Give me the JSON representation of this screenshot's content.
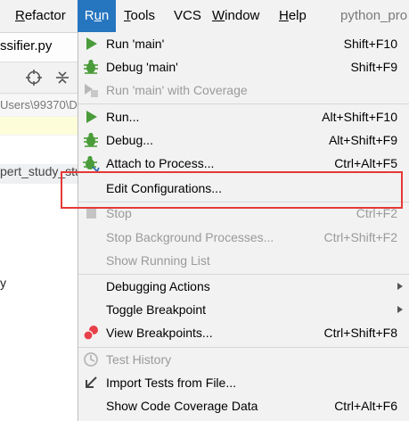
{
  "menubar": {
    "items": [
      {
        "label": "Refactor",
        "mnemonic": "R",
        "rest": "efactor"
      },
      {
        "label": "Run",
        "mnemonic": "u",
        "pre": "R",
        "rest": "n"
      },
      {
        "label": "Tools",
        "mnemonic": "T",
        "rest": "ools"
      },
      {
        "label": "VCS",
        "mnemonic": "",
        "rest": "VCS"
      },
      {
        "label": "Window",
        "mnemonic": "W",
        "rest": "indow"
      },
      {
        "label": "Help",
        "mnemonic": "H",
        "rest": "elp"
      }
    ],
    "project": "python_pro"
  },
  "editor": {
    "tab": "ssifier.py",
    "path": "Users\\99370\\D",
    "tree_item": "pert_study_stu",
    "tree_item2": "y"
  },
  "run_menu": {
    "items": [
      {
        "label": "Run 'main'",
        "shortcut": "Shift+F10"
      },
      {
        "label": "Debug 'main'",
        "shortcut": "Shift+F9"
      },
      {
        "label": "Run 'main' with Coverage",
        "shortcut": ""
      },
      {
        "label": "Run...",
        "shortcut": "Alt+Shift+F10"
      },
      {
        "label": "Debug...",
        "shortcut": "Alt+Shift+F9"
      },
      {
        "label": "Attach to Process...",
        "shortcut": "Ctrl+Alt+F5"
      },
      {
        "label": "Edit Configurations...",
        "shortcut": ""
      },
      {
        "label": "Stop",
        "shortcut": "Ctrl+F2"
      },
      {
        "label": "Stop Background Processes...",
        "shortcut": "Ctrl+Shift+F2"
      },
      {
        "label": "Show Running List",
        "shortcut": ""
      },
      {
        "label": "Debugging Actions",
        "shortcut": ""
      },
      {
        "label": "Toggle Breakpoint",
        "shortcut": ""
      },
      {
        "label": "View Breakpoints...",
        "shortcut": "Ctrl+Shift+F8"
      },
      {
        "label": "Test History",
        "shortcut": ""
      },
      {
        "label": "Import Tests from File...",
        "shortcut": ""
      },
      {
        "label": "Show Code Coverage Data",
        "shortcut": "Ctrl+Alt+F6"
      }
    ]
  },
  "colors": {
    "menu_active": "#2675bf",
    "run_green": "#4a9c3a",
    "highlight_red": "#e53935",
    "breakpoint_red": "#e8404a"
  },
  "icons": {
    "run": "play-icon",
    "debug": "bug-icon",
    "coverage": "coverage-icon",
    "attach": "attach-bug-icon",
    "stop": "stop-icon",
    "breakpoints": "breakpoints-icon",
    "history": "clock-icon",
    "import": "import-arrow-icon"
  }
}
